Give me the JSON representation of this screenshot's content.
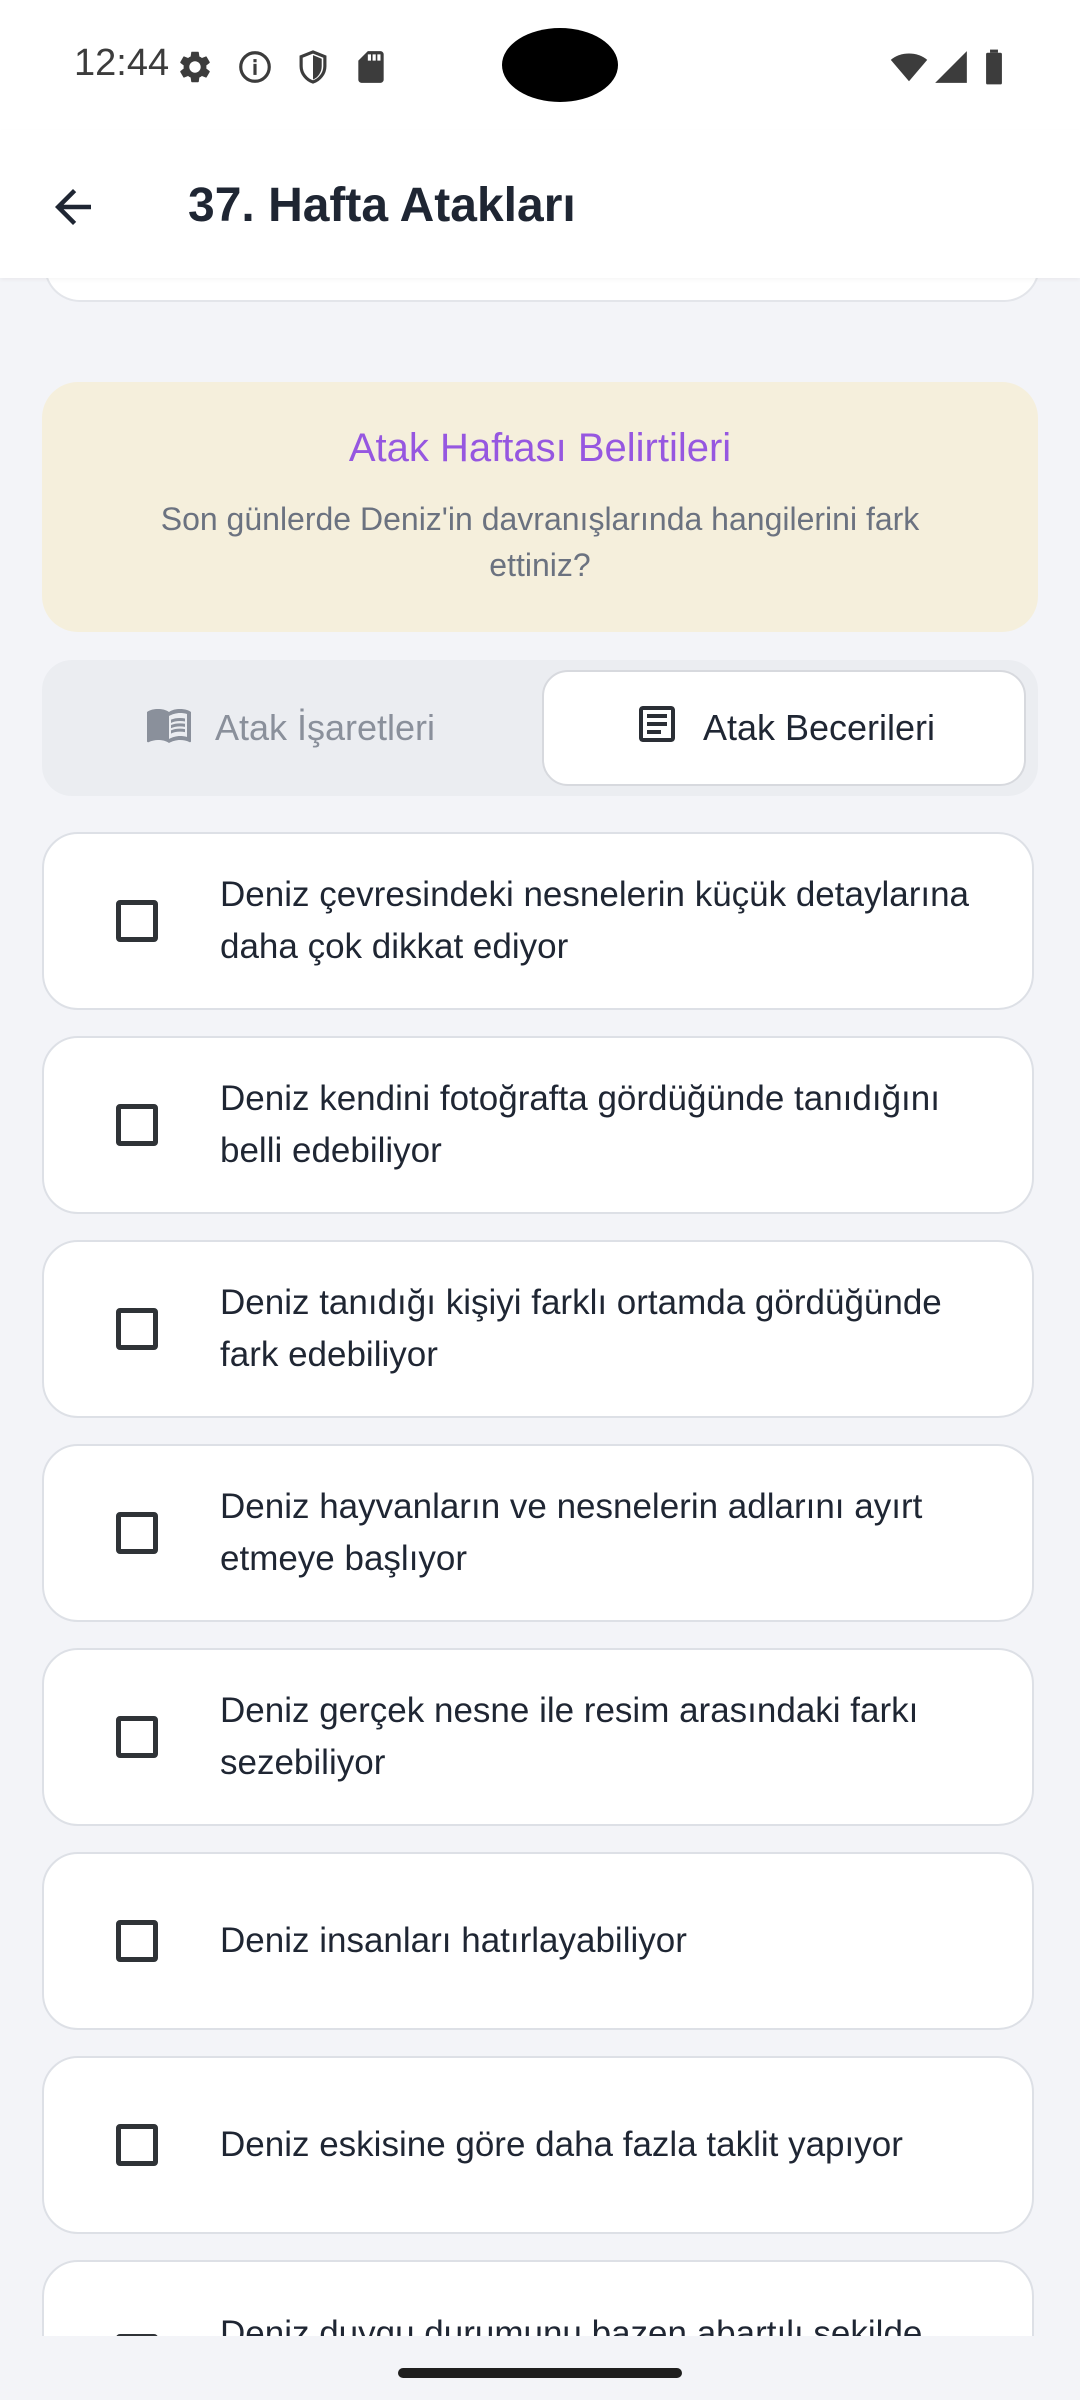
{
  "status_bar": {
    "time": "12:44",
    "icons": [
      "gear-icon",
      "info-icon",
      "shield-icon",
      "sim-card-icon",
      "wifi-icon",
      "signal-icon",
      "battery-icon"
    ]
  },
  "app_bar": {
    "title": "37. Hafta Atakları",
    "back_icon": "arrow-left-icon"
  },
  "banner": {
    "title": "Atak Haftası Belirtileri",
    "subtitle": "Son günlerde Deniz'in davranışlarında hangilerini fark ettiniz?"
  },
  "tabs": [
    {
      "label": "Atak İşaretleri",
      "icon": "book-icon",
      "active": false
    },
    {
      "label": "Atak Becerileri",
      "icon": "document-icon",
      "active": true
    }
  ],
  "items": [
    {
      "text": "Deniz çevresindeki nesnelerin küçük detaylarına daha çok dikkat ediyor",
      "checked": false
    },
    {
      "text": "Deniz kendini fotoğrafta gördüğünde tanıdığını belli edebiliyor",
      "checked": false
    },
    {
      "text": "Deniz tanıdığı kişiyi farklı ortamda gördüğünde fark edebiliyor",
      "checked": false
    },
    {
      "text": "Deniz hayvanların ve nesnelerin adlarını ayırt etmeye başlıyor",
      "checked": false
    },
    {
      "text": "Deniz gerçek nesne ile resim arasındaki farkı sezebiliyor",
      "checked": false
    },
    {
      "text": "Deniz insanları hatırlayabiliyor",
      "checked": false
    },
    {
      "text": "Deniz eskisine göre daha fazla taklit yapıyor",
      "checked": false
    },
    {
      "text": "Deniz duygu durumunu bazen abartılı şekilde",
      "checked": false
    }
  ],
  "colors": {
    "accent_purple": "#9657e0",
    "banner_bg": "#f5efdc",
    "page_bg": "#f3f4f8"
  }
}
